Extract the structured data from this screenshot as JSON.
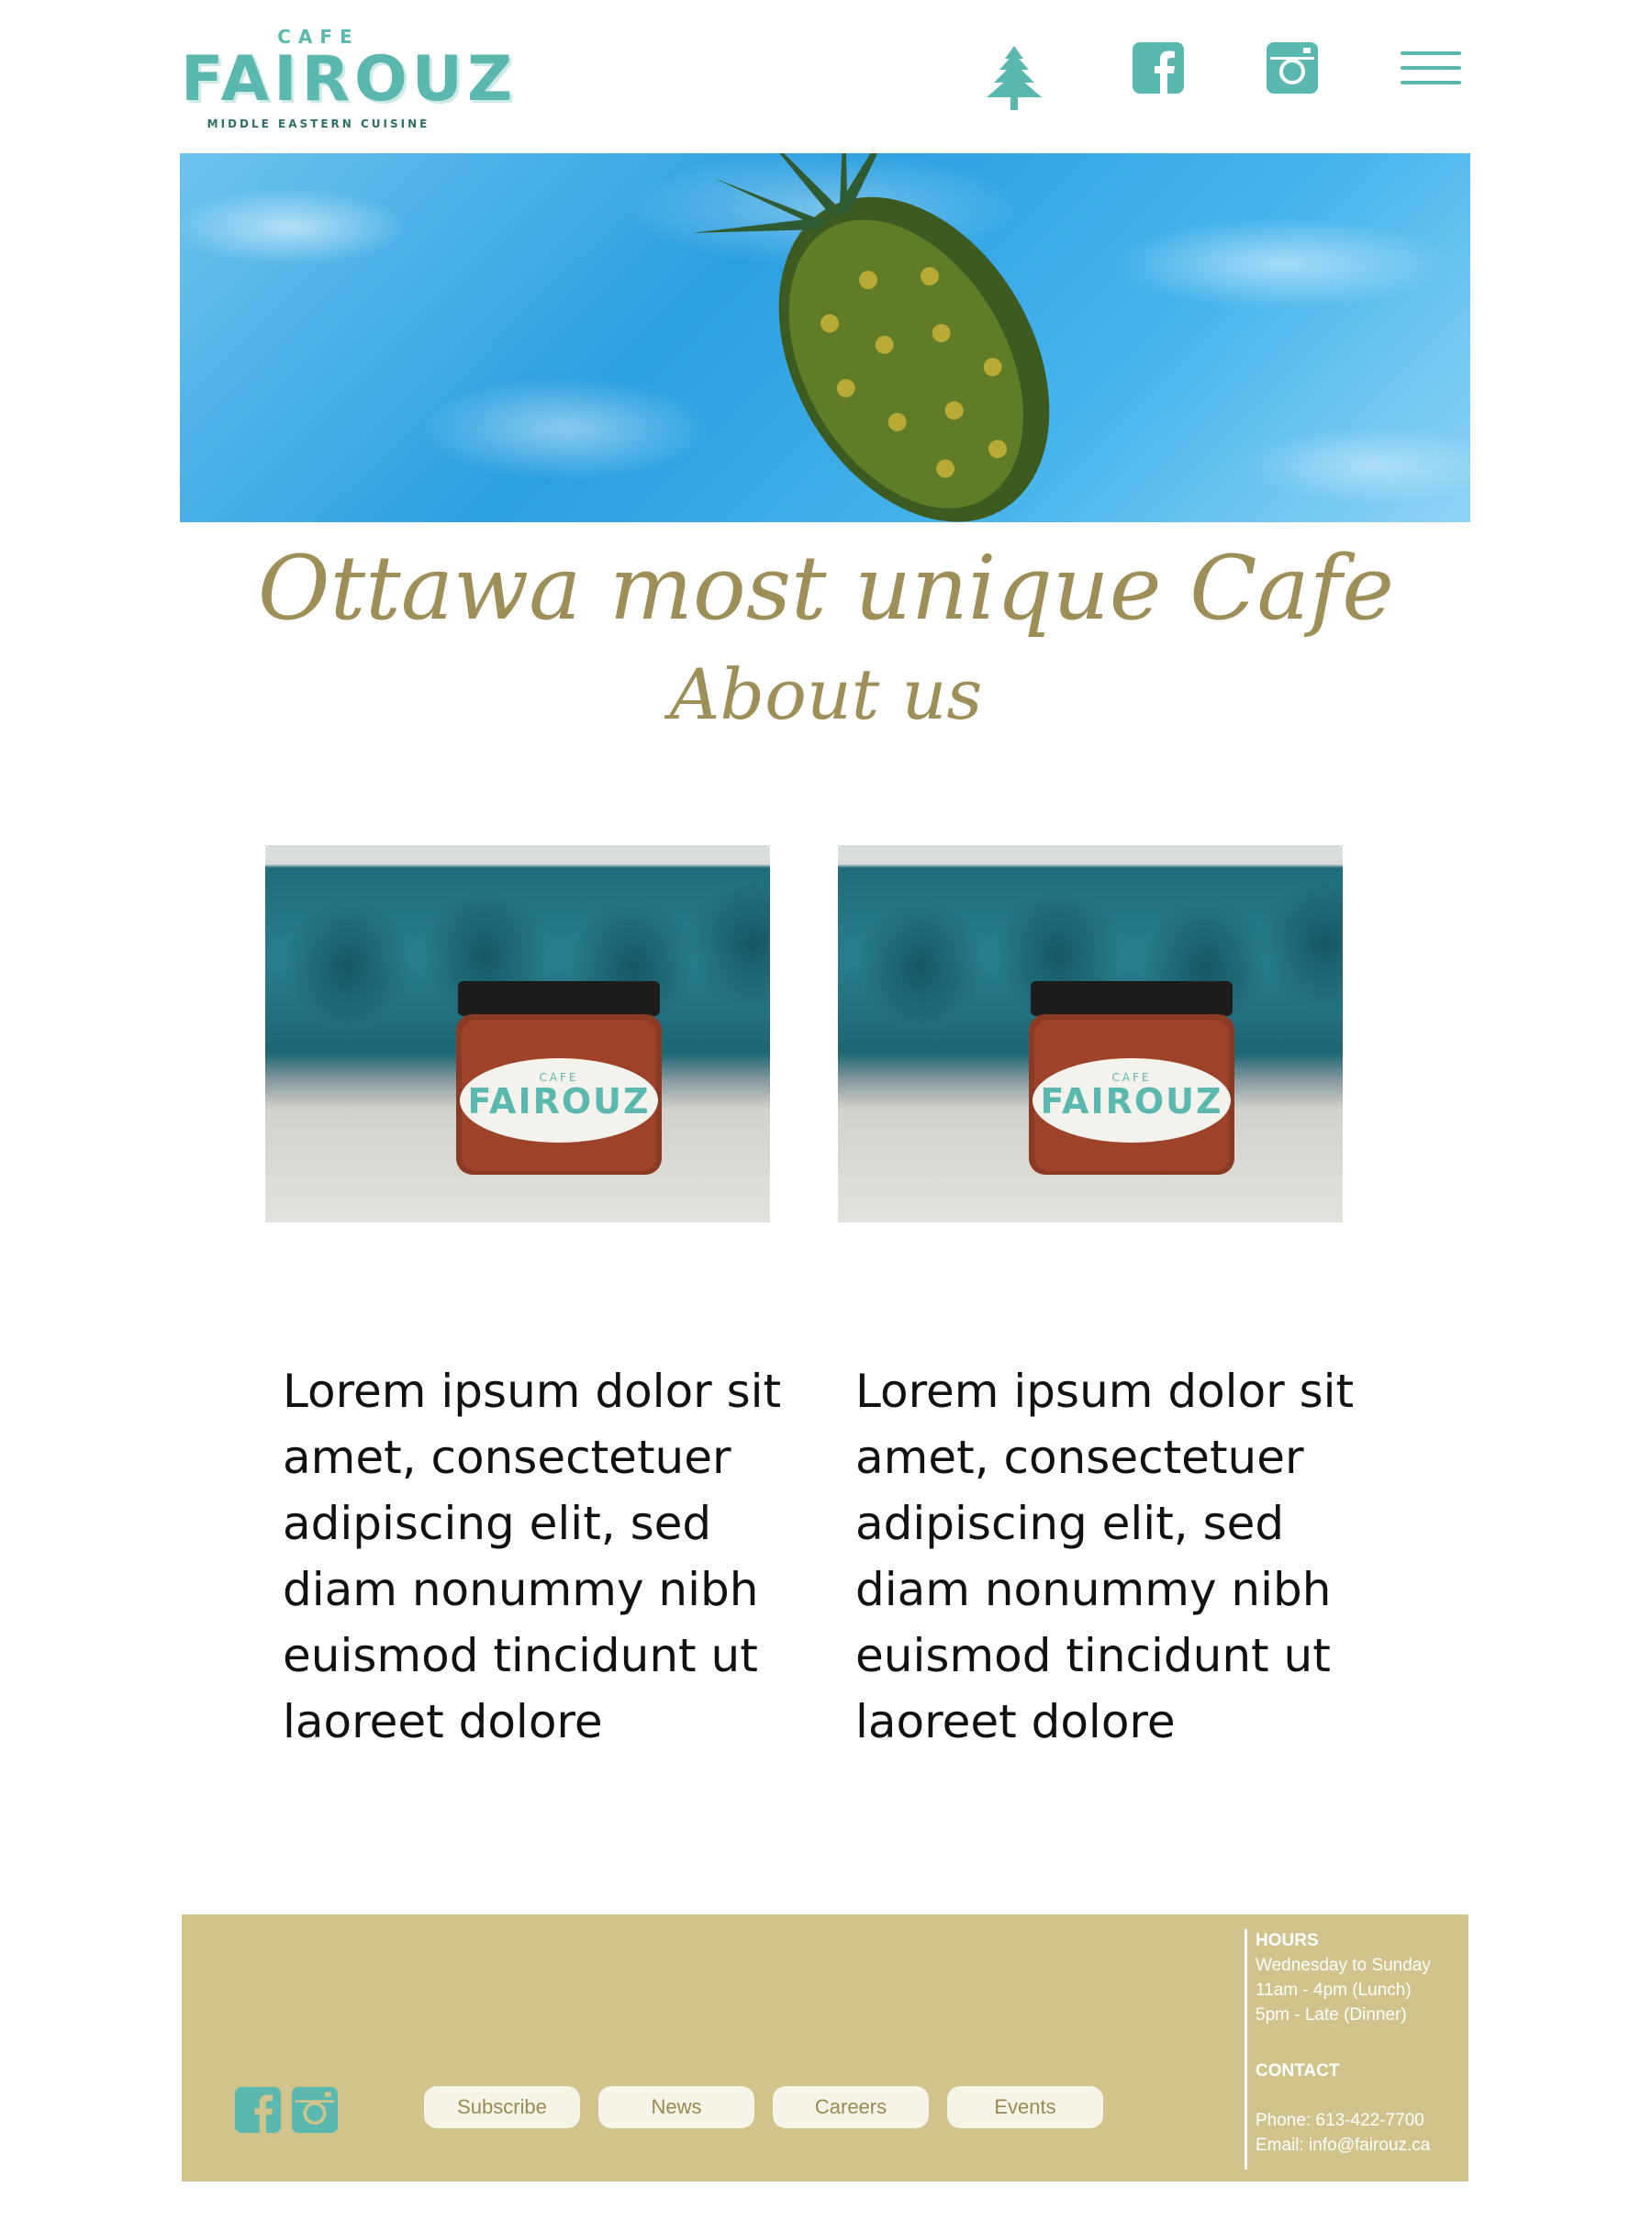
{
  "brand": {
    "cafe": "CAFE",
    "name": "FAIROUZ",
    "tagline": "MIDDLE EASTERN CUISINE"
  },
  "header": {
    "icons": [
      "cedar-icon",
      "facebook-icon",
      "instagram-icon",
      "hamburger-menu-icon"
    ]
  },
  "hero": {
    "title": "Ottawa most unique Cafe",
    "subtitle": "About us"
  },
  "photos": {
    "jar_label_1": "FAIROUZ",
    "jar_label_2": "FAIROUZ",
    "jar_small_1": "CAFE",
    "jar_small_2": "CAFE"
  },
  "columns": {
    "text1": "Lorem ipsum dolor sit amet, consectetuer adipiscing elit, sed diam nonummy nibh euismod tincidunt ut laoreet dolore",
    "text2": "Lorem ipsum dolor sit amet, consectetuer adipiscing elit, sed diam nonummy nibh euismod tincidunt ut laoreet dolore"
  },
  "footer": {
    "buttons": [
      "Subscribe",
      "News",
      "Careers",
      "Events"
    ],
    "hours_heading": "HOURS",
    "hours_days": "Wednesday to Sunday",
    "hours_lunch": "11am - 4pm (Lunch)",
    "hours_dinner": "5pm - Late (Dinner)",
    "contact_heading": "CONTACT",
    "phone": "Phone: 613-422-7700",
    "email": "Email: info@fairouz.ca"
  },
  "colors": {
    "teal": "#5bb8ae",
    "gold": "#9e8e57",
    "footer_bg": "#d0c48c"
  }
}
